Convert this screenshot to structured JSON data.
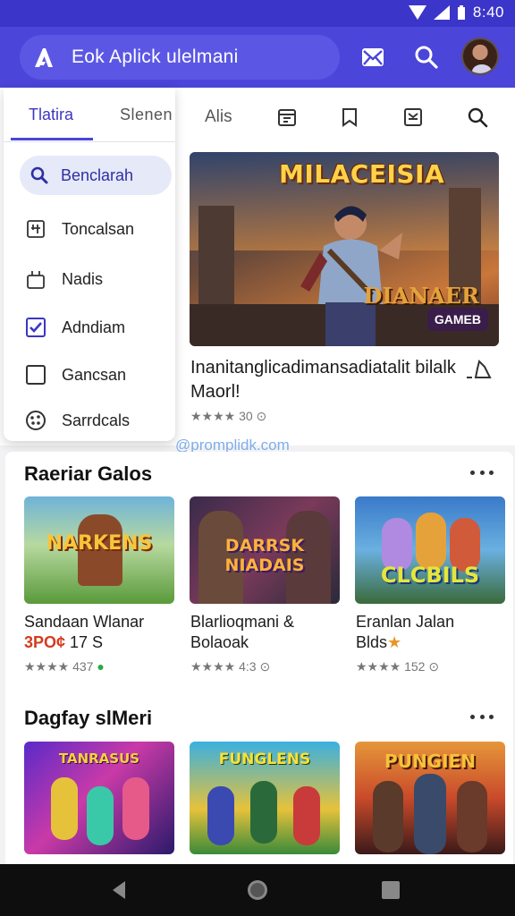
{
  "status": {
    "time": "8:40"
  },
  "app": {
    "title": "Eok Aplick ulelmani"
  },
  "tabs": {
    "alis": "Alis"
  },
  "menu": {
    "tab_active": "Tlatira",
    "tab_inactive": "Slenen",
    "search_label": "Benclarah",
    "items": [
      {
        "label": "Toncalsan",
        "icon": "grid-icon"
      },
      {
        "label": "Nadis",
        "icon": "apps-icon"
      },
      {
        "label": "Adndiam",
        "icon": "checkbox-checked-icon"
      },
      {
        "label": "Gancsan",
        "icon": "checkbox-empty-icon"
      },
      {
        "label": "Sarrdcals",
        "icon": "palette-icon"
      }
    ]
  },
  "featured": {
    "art_title": "MILACEISIA",
    "art_subtitle": "DIANAER",
    "badge": "GAMEB",
    "description": "Inanitanglicadimansadiatalit bilalk Maorl!",
    "rating": "★★★★ 30 ⊙",
    "stars": 4
  },
  "watermark": "@promplidk.com",
  "sections": [
    {
      "title": "Raeriar Galos",
      "games": [
        {
          "name_line1": "Sandaan Wlanar",
          "price": "3PO¢",
          "name_line2": " 17 S",
          "rating": "★★★★ 437",
          "art_title": "NARKENS"
        },
        {
          "name_line1": "Blarlioqmani &",
          "name_line2": "Bolaoak",
          "rating": "★★★★ 4:3",
          "art_title": "DARRSK NIADAIS"
        },
        {
          "name_line1": "Eranlan Jalan",
          "name_line2": "Blds",
          "rating": "★★★★ 152",
          "art_title": "CLCBILS"
        }
      ]
    },
    {
      "title": "Dagfay slMeri",
      "games": [
        {
          "art_title": "TANRASUS"
        },
        {
          "art_title": "FUNGLENS"
        },
        {
          "art_title": "PUNGIEN"
        }
      ]
    }
  ],
  "colors": {
    "primary": "#4b45d9",
    "status": "#3b35c9",
    "accent": "#2e2fa3"
  }
}
